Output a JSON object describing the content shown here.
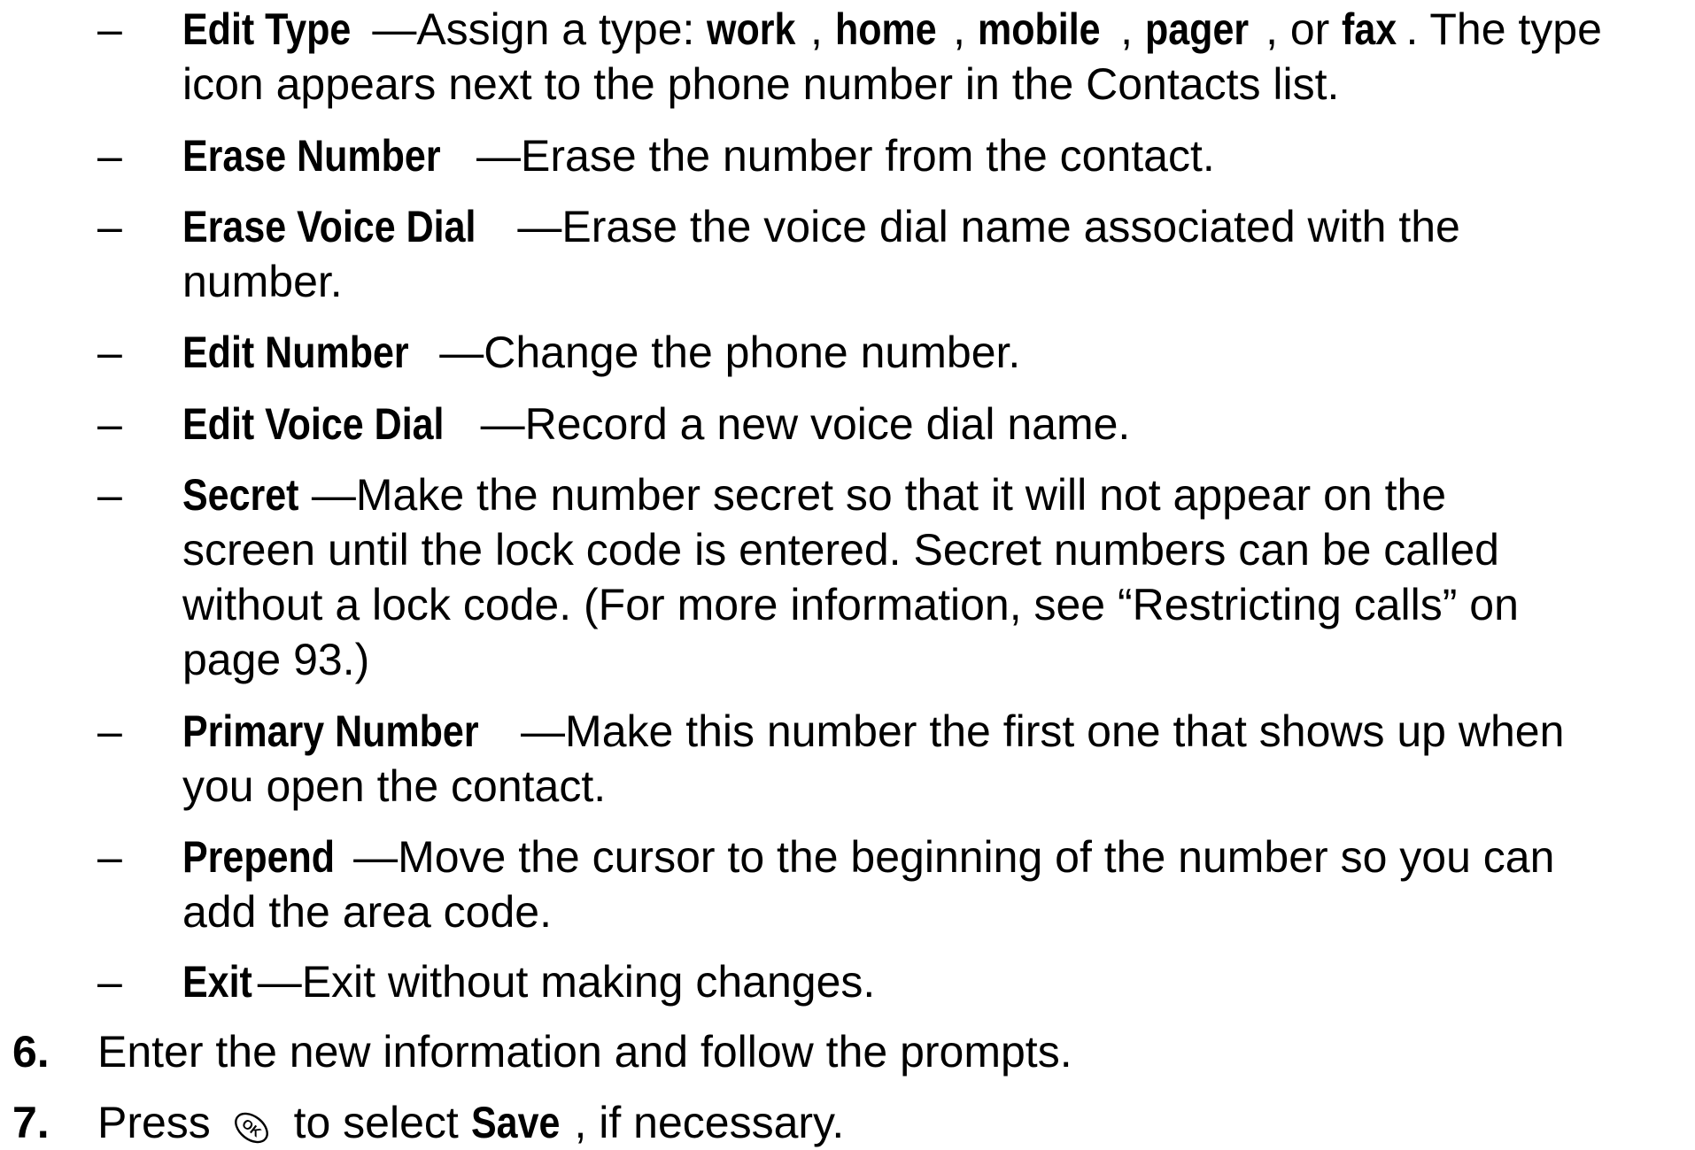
{
  "sub_items": [
    {
      "dash": "–",
      "term": "Edit Type",
      "separator": "—",
      "lines": [
        "",
        "icon appears next to the phone number in the Contacts list."
      ],
      "first_line_parts": [
        {
          "text": "Assign a type: ",
          "bold": false
        },
        {
          "text": "work",
          "bold": true
        },
        {
          "text": ", ",
          "bold": false
        },
        {
          "text": "home",
          "bold": true
        },
        {
          "text": ", ",
          "bold": false
        },
        {
          "text": "mobile",
          "bold": true
        },
        {
          "text": ", ",
          "bold": false
        },
        {
          "text": "pager",
          "bold": true
        },
        {
          "text": ", or ",
          "bold": false
        },
        {
          "text": "fax",
          "bold": true
        },
        {
          "text": ". The type",
          "bold": false
        }
      ]
    },
    {
      "dash": "–",
      "term": "Erase Number",
      "separator": "—",
      "lines": [
        "Erase the number from the contact."
      ]
    },
    {
      "dash": "–",
      "term": "Erase Voice Dial",
      "separator": "—",
      "lines": [
        "Erase the voice dial name associated with the",
        "number."
      ]
    },
    {
      "dash": "–",
      "term": "Edit Number",
      "separator": "—",
      "lines": [
        "Change the phone number."
      ]
    },
    {
      "dash": "–",
      "term": "Edit Voice Dial",
      "separator": "—",
      "lines": [
        "Record a new voice dial name."
      ]
    },
    {
      "dash": "–",
      "term": "Secret",
      "separator": "—",
      "lines": [
        "Make the number secret so that it will not appear on the",
        "screen until the lock code is entered. Secret numbers can be called",
        "without a lock code. (For more information, see “Restricting calls” on",
        "page 93.)"
      ]
    },
    {
      "dash": "–",
      "term": "Primary Number",
      "separator": "—",
      "lines": [
        "Make this number the first one that shows up when",
        "you open the contact."
      ]
    },
    {
      "dash": "–",
      "term": "Prepend",
      "separator": "—",
      "lines": [
        "Move the cursor to the beginning of the number so you can",
        "add the area code."
      ]
    },
    {
      "dash": "–",
      "term": "Exit",
      "separator": "—",
      "lines": [
        "Exit without making changes."
      ]
    }
  ],
  "steps": [
    {
      "number": "6.",
      "text": "Enter the new information and follow the prompts."
    },
    {
      "number": "7.",
      "text_before": "Press ",
      "key_icon": "ok-key-icon",
      "text_middle": " to select ",
      "bold": "Save",
      "text_after": ", if necessary."
    }
  ]
}
